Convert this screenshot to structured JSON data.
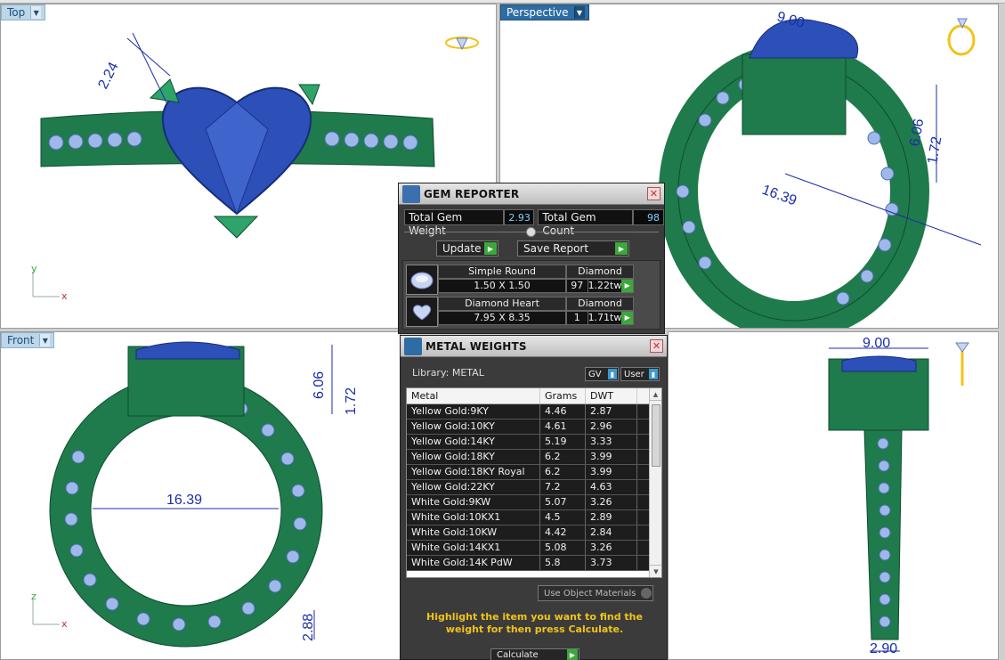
{
  "viewports": {
    "top": {
      "label": "Top",
      "axis_x": "x",
      "axis_y": "y",
      "dims": [
        "2.24"
      ]
    },
    "perspective": {
      "label": "Perspective",
      "dims": [
        "6.06",
        "1.72",
        "16.39",
        "9.00"
      ]
    },
    "front": {
      "label": "Front",
      "axis_x": "x",
      "axis_y": "z",
      "dims": [
        "6.06",
        "1.72",
        "16.39",
        "2.88"
      ]
    },
    "right": {
      "dims": [
        "9.00",
        "2.90"
      ]
    }
  },
  "gem_reporter": {
    "title": "GEM REPORTER",
    "total_weight_label": "Total Gem Weight",
    "total_weight_value": "2.93",
    "total_count_label": "Total Gem Count",
    "total_count_value": "98",
    "update_label": "Update",
    "save_report_label": "Save Report",
    "gems": [
      {
        "shape": "Simple Round",
        "material": "Diamond",
        "size": "1.50 X 1.50",
        "count": "97",
        "weight": "1.22tw"
      },
      {
        "shape": "Diamond Heart",
        "material": "Diamond",
        "size": "7.95 X 8.35",
        "count": "1",
        "weight": "1.71tw"
      }
    ]
  },
  "metal_weights": {
    "title": "METAL WEIGHTS",
    "library_label": "Library: METAL",
    "gv_label": "GV",
    "user_label": "User",
    "columns": [
      "Metal",
      "Grams",
      "DWT"
    ],
    "rows": [
      [
        "Yellow Gold:9KY",
        "4.46",
        "2.87"
      ],
      [
        "Yellow Gold:10KY",
        "4.61",
        "2.96"
      ],
      [
        "Yellow Gold:14KY",
        "5.19",
        "3.33"
      ],
      [
        "Yellow Gold:18KY",
        "6.2",
        "3.99"
      ],
      [
        "Yellow Gold:18KY Royal",
        "6.2",
        "3.99"
      ],
      [
        "Yellow Gold:22KY",
        "7.2",
        "4.63"
      ],
      [
        "White Gold:9KW",
        "5.07",
        "3.26"
      ],
      [
        "White Gold:10KX1",
        "4.5",
        "2.89"
      ],
      [
        "White Gold:10KW",
        "4.42",
        "2.84"
      ],
      [
        "White Gold:14KX1",
        "5.08",
        "3.26"
      ],
      [
        "White Gold:14K PdW",
        "5.8",
        "3.73"
      ]
    ],
    "use_object_materials_label": "Use Object Materials",
    "hint": "Highlight the item you want to find the weight for then press Calculate.",
    "calculate_label": "Calculate"
  },
  "colors": {
    "metal": "#1f7a4c",
    "gem": "#2c4fb8",
    "dimension": "#1b2ea8",
    "accent_yellow": "#f0c419"
  }
}
